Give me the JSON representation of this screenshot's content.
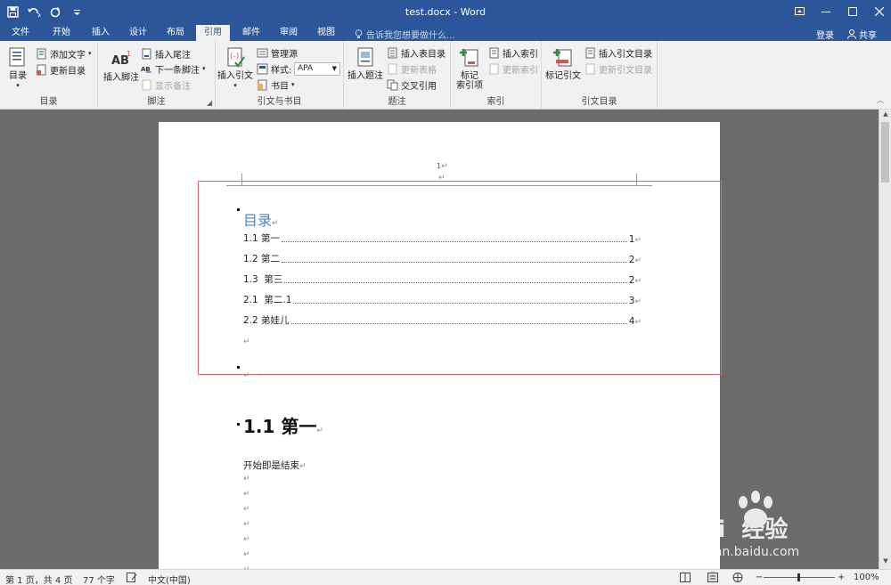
{
  "window": {
    "title": "test.docx - Word"
  },
  "tabs": [
    {
      "label": "文件"
    },
    {
      "label": "开始"
    },
    {
      "label": "插入"
    },
    {
      "label": "设计"
    },
    {
      "label": "布局"
    },
    {
      "label": "引用"
    },
    {
      "label": "邮件"
    },
    {
      "label": "审阅"
    },
    {
      "label": "视图"
    }
  ],
  "tell_me": "告诉我您想要做什么...",
  "account": {
    "login": "登录",
    "share": "共享"
  },
  "ribbon": {
    "toc": {
      "toc_btn": "目录",
      "add_text": "添加文字",
      "update_toc": "更新目录",
      "label": "目录"
    },
    "footnotes": {
      "insert_footnote": "插入脚注",
      "insert_endnote": "插入尾注",
      "next_footnote": "下一条脚注",
      "show_notes": "显示备注",
      "label": "脚注"
    },
    "citations": {
      "insert_citation": "插入引文",
      "manage_sources": "管理源",
      "style_label": "样式:",
      "style_value": "APA",
      "bibliography": "书目",
      "label": "引文与书目"
    },
    "captions": {
      "insert_caption": "插入题注",
      "insert_tof": "插入表目录",
      "update_table": "更新表格",
      "cross_ref": "交叉引用",
      "label": "题注"
    },
    "index": {
      "mark_entry_1": "标记",
      "mark_entry_2": "索引项",
      "insert_index": "插入索引",
      "update_index": "更新索引",
      "label": "索引"
    },
    "toa": {
      "mark_citation": "标记引文",
      "insert_toa": "插入引文目录",
      "update_toa": "更新引文目录",
      "label": "引文目录"
    }
  },
  "document": {
    "header_page_number": "1",
    "toc_title": "目录",
    "toc_entries": [
      {
        "label": "1.1 第一",
        "page": "1"
      },
      {
        "label": "1.2 第二",
        "page": "2"
      },
      {
        "label": "1.3  第三",
        "page": "2"
      },
      {
        "label": "2.1  第二.1",
        "page": "3"
      },
      {
        "label": "2.2 弟娃儿",
        "page": "4"
      }
    ],
    "heading": "1.1 第一",
    "body": "开始即是结束"
  },
  "statusbar": {
    "page": "第 1 页，共 4 页",
    "words": "77 个字",
    "language": "中文(中国)",
    "zoom": "100%"
  },
  "watermark": {
    "brand": "Bai  经验",
    "url": "jingyan.baidu.com"
  },
  "colors": {
    "word_blue": "#2b579a",
    "toc_title": "#4a86c5",
    "frame_red": "#e26464"
  }
}
